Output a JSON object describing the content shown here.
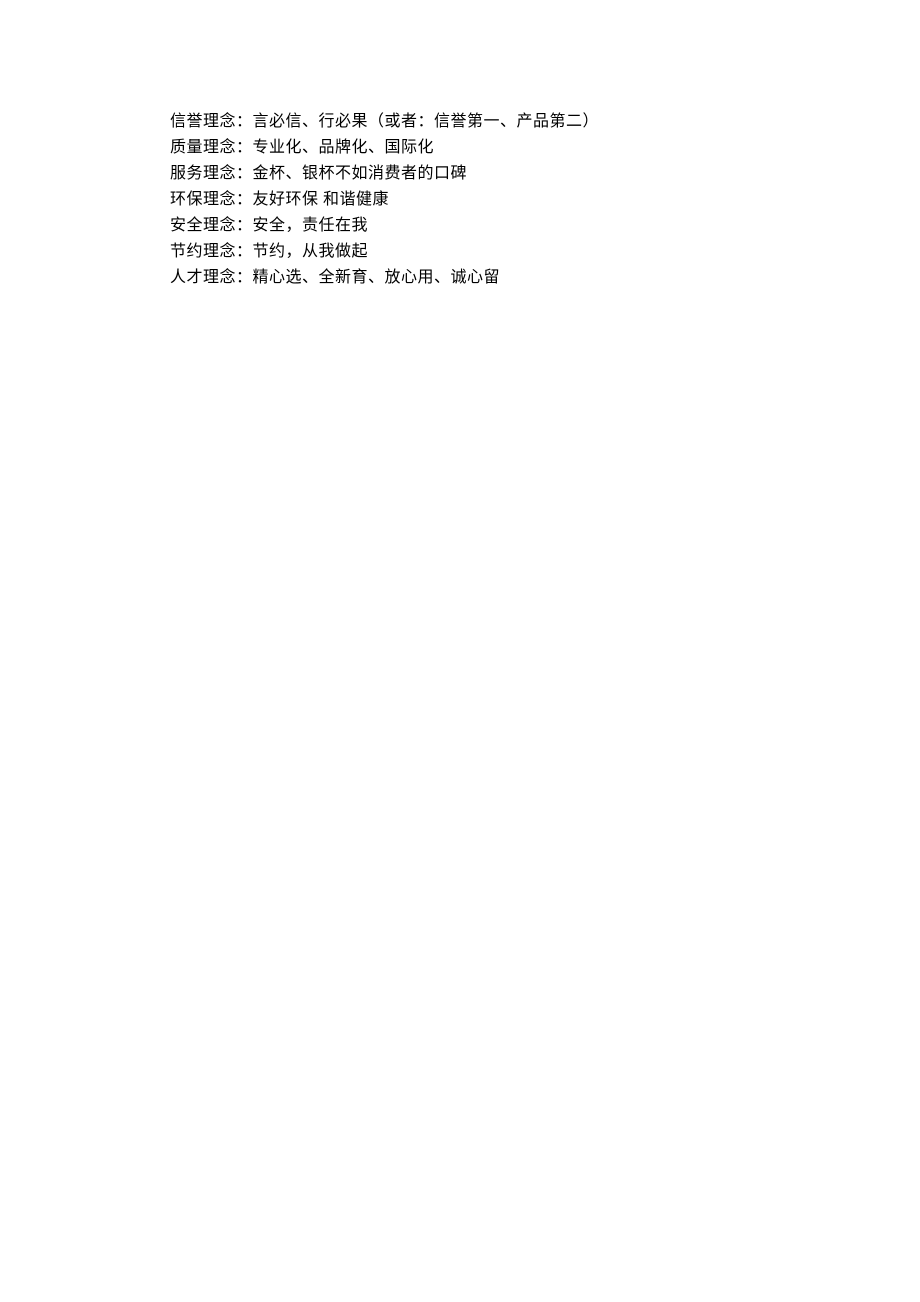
{
  "concepts": [
    {
      "label": "信誉理念：",
      "text": "言必信、行必果（或者：信誉第一、产品第二）"
    },
    {
      "label": "质量理念：",
      "text": "专业化、品牌化、国际化"
    },
    {
      "label": "服务理念：",
      "text": "金杯、银杯不如消费者的口碑"
    },
    {
      "label": "环保理念：",
      "text": "友好环保 和谐健康"
    },
    {
      "label": "安全理念：",
      "text": "安全，责任在我"
    },
    {
      "label": "节约理念：",
      "text": "节约，从我做起"
    },
    {
      "label": "人才理念：",
      "text": "精心选、全新育、放心用、诚心留"
    }
  ]
}
